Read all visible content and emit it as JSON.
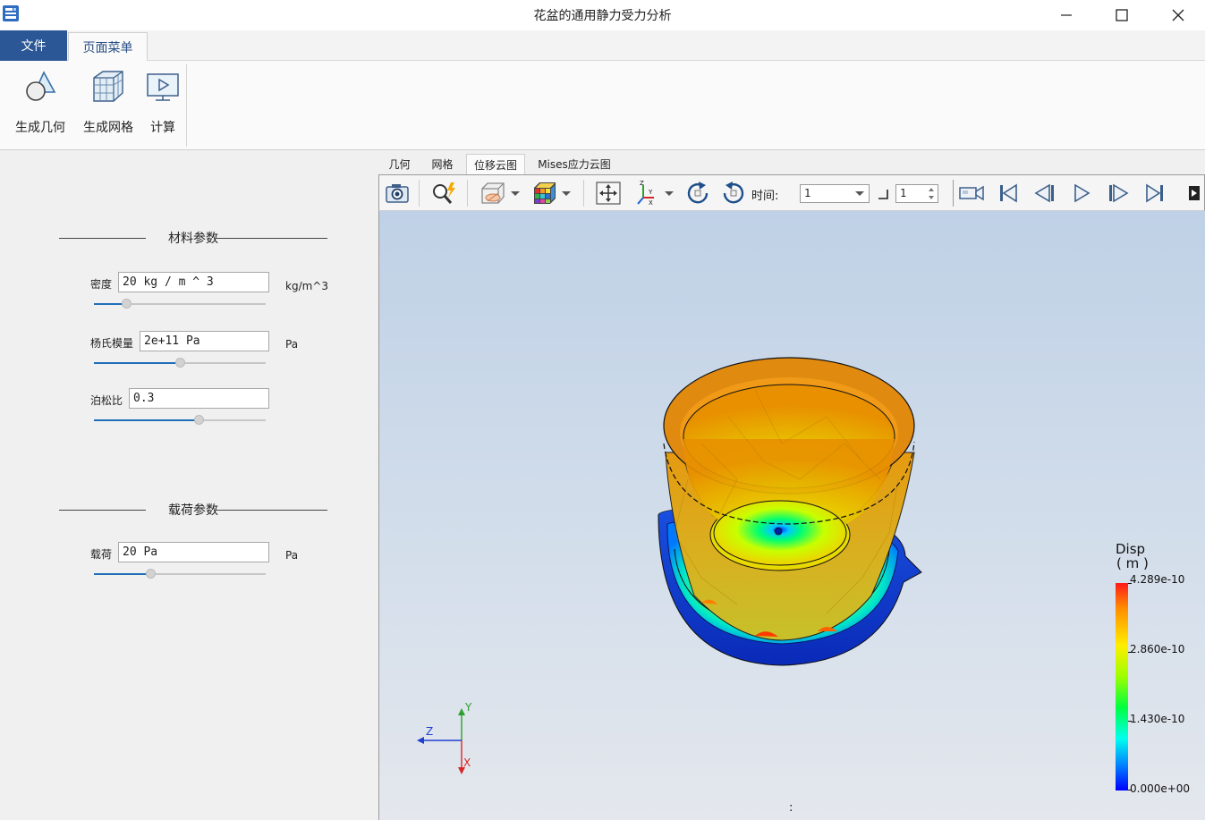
{
  "window": {
    "title": "花盆的通用静力受力分析"
  },
  "ribbon": {
    "tabs": [
      "文件",
      "页面菜单"
    ],
    "buttons": [
      {
        "label": "生成几何",
        "icon": "geometry-icon"
      },
      {
        "label": "生成网格",
        "icon": "mesh-icon"
      },
      {
        "label": "计算",
        "icon": "compute-icon"
      }
    ]
  },
  "left_panel": {
    "material_group": "材料参数",
    "density": {
      "label": "密度",
      "value": "20 kg / m ^ 3",
      "unit": "kg/m^3",
      "slider": 0.19
    },
    "youngs": {
      "label": "杨氏模量",
      "value": "2e+11 Pa",
      "unit": "Pa",
      "slider": 0.5
    },
    "poisson": {
      "label": "泊松比",
      "value": "0.3",
      "slider": 0.61
    },
    "load_group": "载荷参数",
    "load": {
      "label": "载荷",
      "value": "20 Pa",
      "unit": "Pa",
      "slider": 0.33
    }
  },
  "view_tabs": [
    "几何",
    "网格",
    "位移云图",
    "Mises应力云图"
  ],
  "active_view_tab": 2,
  "toolbar": {
    "time_label": "时间:",
    "time_value": "1",
    "step_value": "1"
  },
  "legend": {
    "title_line1": "Disp",
    "title_line2": "( m )",
    "labels": [
      "4.289e-10",
      "2.860e-10",
      "1.430e-10",
      "0.000e+00"
    ]
  },
  "axes": {
    "y": "Y",
    "z": "Z",
    "x": "X"
  },
  "viewport_mark": ":",
  "colors": {
    "file_tab": "#2b5797",
    "accent": "#1f6fb8"
  }
}
